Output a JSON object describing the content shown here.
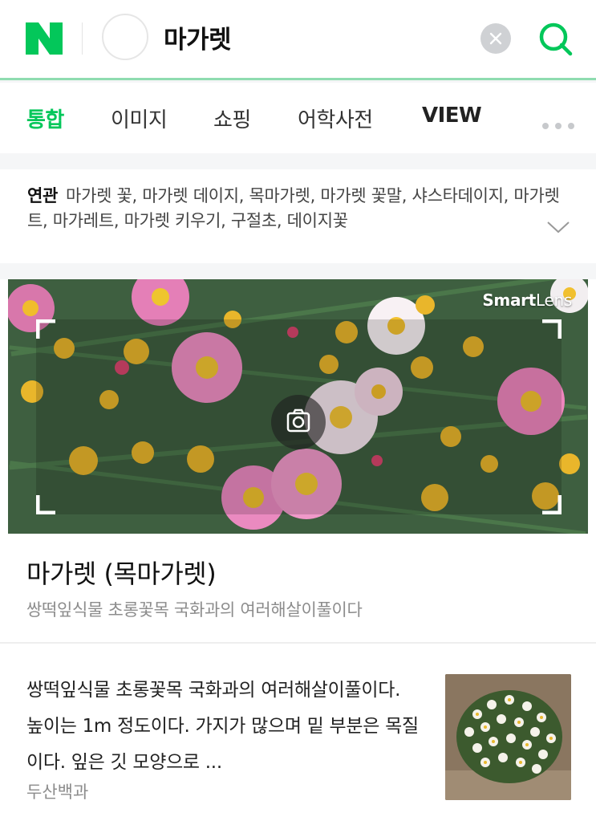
{
  "search": {
    "logo_letter": "N",
    "query": "마가렛"
  },
  "tabs": [
    {
      "label": "통합",
      "active": true
    },
    {
      "label": "이미지",
      "active": false
    },
    {
      "label": "쇼핑",
      "active": false
    },
    {
      "label": "어학사전",
      "active": false
    },
    {
      "label": "VIEW",
      "active": false
    }
  ],
  "related": {
    "heading": "연관",
    "text": "마가렛 꽃, 마가렛 데이지, 목마가렛, 마가렛 꽃말, 샤스타데이지, 마가렛트, 마가레트, 마가렛 키우기, 구절초, 데이지꽃"
  },
  "card": {
    "lens_brand_bold": "Smart",
    "lens_brand_light": "Lens",
    "title": "마가렛 (목마가렛)",
    "subtitle": "쌍떡잎식물 초롱꽃목 국화과의 여러해살이풀이다",
    "description": "쌍떡잎식물 초롱꽃목 국화과의 여러해살이풀이다. 높이는 1m 정도이다. 가지가 많으며 밑 부분은 목질이다. 잎은 깃 모양으로 ...",
    "source": "두산백과"
  },
  "colors": {
    "brand_green": "#03c75a",
    "underline": "#8fdcb0"
  },
  "icons": [
    "naver-logo",
    "smartlens-icon",
    "clear-icon",
    "search-icon",
    "more-icon",
    "chevron-down-icon",
    "camera-scan-icon"
  ]
}
